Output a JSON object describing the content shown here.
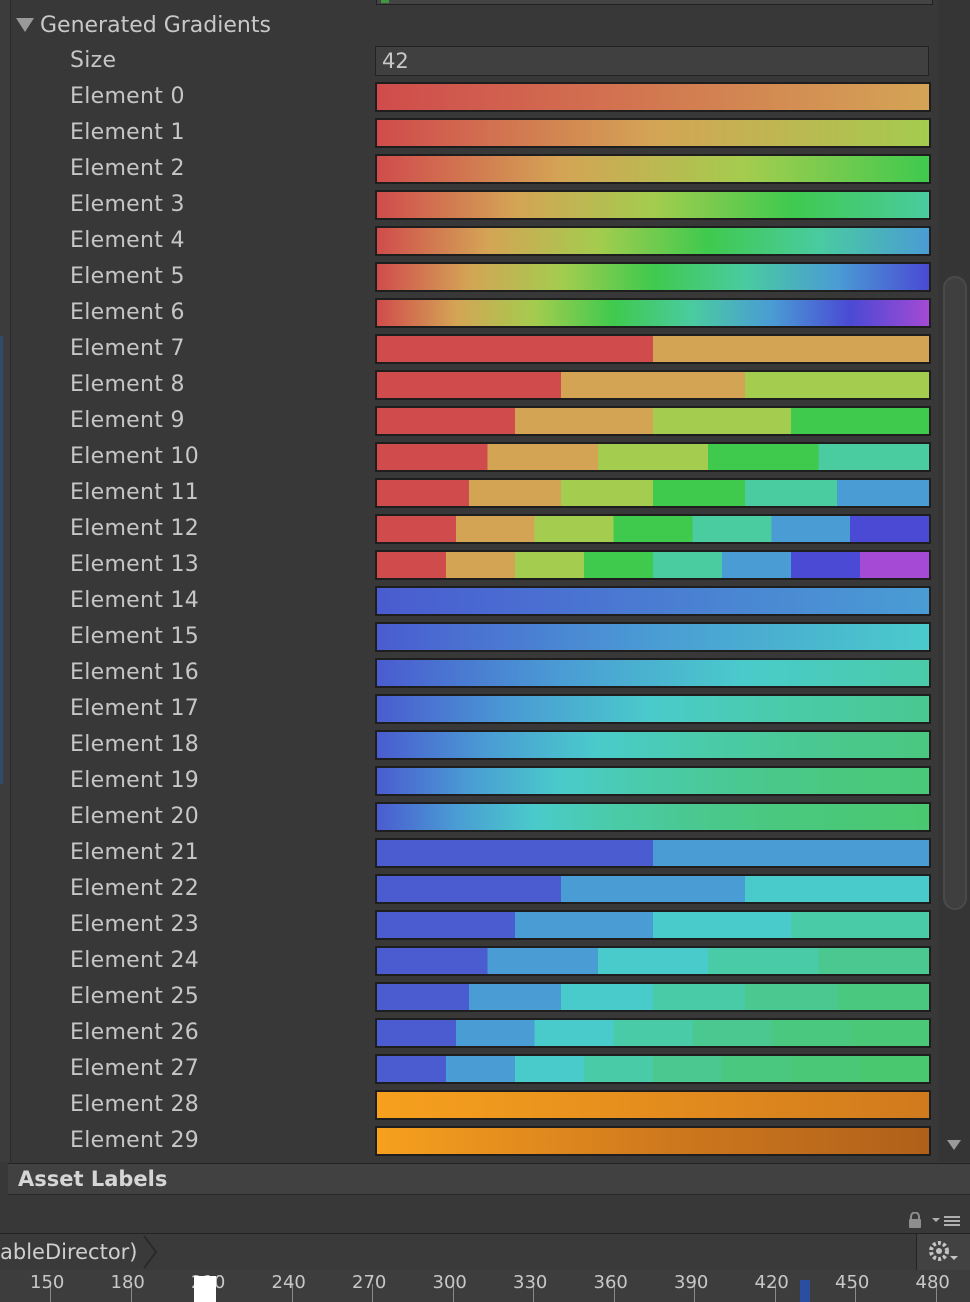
{
  "foldout": {
    "label": "Generated Gradients"
  },
  "size": {
    "label": "Size",
    "value": "42"
  },
  "elements": [
    {
      "label": "Element 0",
      "type": "blend",
      "colors": [
        "#d04c4c",
        "#d4a455"
      ]
    },
    {
      "label": "Element 1",
      "type": "blend",
      "colors": [
        "#d04c4c",
        "#d4a455",
        "#a4cc4e"
      ]
    },
    {
      "label": "Element 2",
      "type": "blend",
      "colors": [
        "#d04c4c",
        "#d4a455",
        "#a4cc4e",
        "#3fca4e"
      ]
    },
    {
      "label": "Element 3",
      "type": "blend",
      "colors": [
        "#d04c4c",
        "#d4a455",
        "#a4cc4e",
        "#3fca4e",
        "#4acba0"
      ]
    },
    {
      "label": "Element 4",
      "type": "blend",
      "colors": [
        "#d04c4c",
        "#d4a455",
        "#a4cc4e",
        "#3fca4e",
        "#4acba0",
        "#4a9cd4"
      ]
    },
    {
      "label": "Element 5",
      "type": "blend",
      "colors": [
        "#d04c4c",
        "#d4a455",
        "#a4cc4e",
        "#3fca4e",
        "#4acba0",
        "#4a9cd4",
        "#4a4ad4"
      ]
    },
    {
      "label": "Element 6",
      "type": "blend",
      "colors": [
        "#d04c4c",
        "#d4a455",
        "#a4cc4e",
        "#3fca4e",
        "#4acba0",
        "#4a9cd4",
        "#4a4ad4",
        "#a44ad4"
      ]
    },
    {
      "label": "Element 7",
      "type": "fixed",
      "colors": [
        "#d04c4c",
        "#d4a455"
      ]
    },
    {
      "label": "Element 8",
      "type": "fixed",
      "colors": [
        "#d04c4c",
        "#d4a455",
        "#a4cc4e"
      ]
    },
    {
      "label": "Element 9",
      "type": "fixed",
      "colors": [
        "#d04c4c",
        "#d4a455",
        "#a4cc4e",
        "#3fca4e"
      ]
    },
    {
      "label": "Element 10",
      "type": "fixed",
      "colors": [
        "#d04c4c",
        "#d4a455",
        "#a4cc4e",
        "#3fca4e",
        "#4acba0"
      ]
    },
    {
      "label": "Element 11",
      "type": "fixed",
      "colors": [
        "#d04c4c",
        "#d4a455",
        "#a4cc4e",
        "#3fca4e",
        "#4acba0",
        "#4a9cd4"
      ]
    },
    {
      "label": "Element 12",
      "type": "fixed",
      "colors": [
        "#d04c4c",
        "#d4a455",
        "#a4cc4e",
        "#3fca4e",
        "#4acba0",
        "#4a9cd4",
        "#4a4ad4"
      ]
    },
    {
      "label": "Element 13",
      "type": "fixed",
      "colors": [
        "#d04c4c",
        "#d4a455",
        "#a4cc4e",
        "#3fca4e",
        "#4acba0",
        "#4a9cd4",
        "#4a4ad4",
        "#a44ad4"
      ]
    },
    {
      "label": "Element 14",
      "type": "blend",
      "colors": [
        "#4a5cd0",
        "#4a9cd4"
      ]
    },
    {
      "label": "Element 15",
      "type": "blend",
      "colors": [
        "#4a5cd0",
        "#4a9cd4",
        "#4acbcb"
      ]
    },
    {
      "label": "Element 16",
      "type": "blend",
      "colors": [
        "#4a5cd0",
        "#4a9cd4",
        "#4acbcb",
        "#4acba8"
      ]
    },
    {
      "label": "Element 17",
      "type": "blend",
      "colors": [
        "#4a5cd0",
        "#4a9cd4",
        "#4acbcb",
        "#4acba8",
        "#4ac890"
      ]
    },
    {
      "label": "Element 18",
      "type": "blend",
      "colors": [
        "#4a5cd0",
        "#4a9cd4",
        "#4acbcb",
        "#4acba8",
        "#4ac890",
        "#4ac880"
      ]
    },
    {
      "label": "Element 19",
      "type": "blend",
      "colors": [
        "#4a5cd0",
        "#4a9cd4",
        "#4acbcb",
        "#4acba8",
        "#4ac890",
        "#4ac880",
        "#4ac878"
      ]
    },
    {
      "label": "Element 20",
      "type": "blend",
      "colors": [
        "#4a5cd0",
        "#4a9cd4",
        "#4acbcb",
        "#4acba8",
        "#4ac890",
        "#4ac880",
        "#4ac878",
        "#4ac870"
      ]
    },
    {
      "label": "Element 21",
      "type": "fixed",
      "colors": [
        "#4a5cd0",
        "#4a9cd4"
      ]
    },
    {
      "label": "Element 22",
      "type": "fixed",
      "colors": [
        "#4a5cd0",
        "#4a9cd4",
        "#4acbcb"
      ]
    },
    {
      "label": "Element 23",
      "type": "fixed",
      "colors": [
        "#4a5cd0",
        "#4a9cd4",
        "#4acbcb",
        "#4acba8"
      ]
    },
    {
      "label": "Element 24",
      "type": "fixed",
      "colors": [
        "#4a5cd0",
        "#4a9cd4",
        "#4acbcb",
        "#4acba8",
        "#4ac890"
      ]
    },
    {
      "label": "Element 25",
      "type": "fixed",
      "colors": [
        "#4a5cd0",
        "#4a9cd4",
        "#4acbcb",
        "#4acba8",
        "#4ac890",
        "#4ac880"
      ]
    },
    {
      "label": "Element 26",
      "type": "fixed",
      "colors": [
        "#4a5cd0",
        "#4a9cd4",
        "#4acbcb",
        "#4acba8",
        "#4ac890",
        "#4ac880",
        "#4ac878"
      ]
    },
    {
      "label": "Element 27",
      "type": "fixed",
      "colors": [
        "#4a5cd0",
        "#4a9cd4",
        "#4acbcb",
        "#4acba8",
        "#4ac890",
        "#4ac880",
        "#4ac878",
        "#4ac870"
      ]
    },
    {
      "label": "Element 28",
      "type": "blend",
      "colors": [
        "#f7a01e",
        "#d07a1e"
      ]
    },
    {
      "label": "Element 29",
      "type": "blend",
      "colors": [
        "#f7a01e",
        "#d07a1e",
        "#b0601a"
      ]
    }
  ],
  "asset_labels": {
    "label": "Asset Labels"
  },
  "breadcrumb": {
    "label": "ableDirector)"
  },
  "icons": {
    "lock": "lock-icon",
    "menu": "panel-menu-icon",
    "gear": "gear-icon",
    "foldout": "foldout-triangle-icon",
    "scroll": "scroll-down-arrow-icon"
  },
  "timeline": {
    "ticks": [
      "150",
      "180",
      "210",
      "240",
      "270",
      "300",
      "330",
      "360",
      "390",
      "420",
      "450",
      "480"
    ]
  }
}
